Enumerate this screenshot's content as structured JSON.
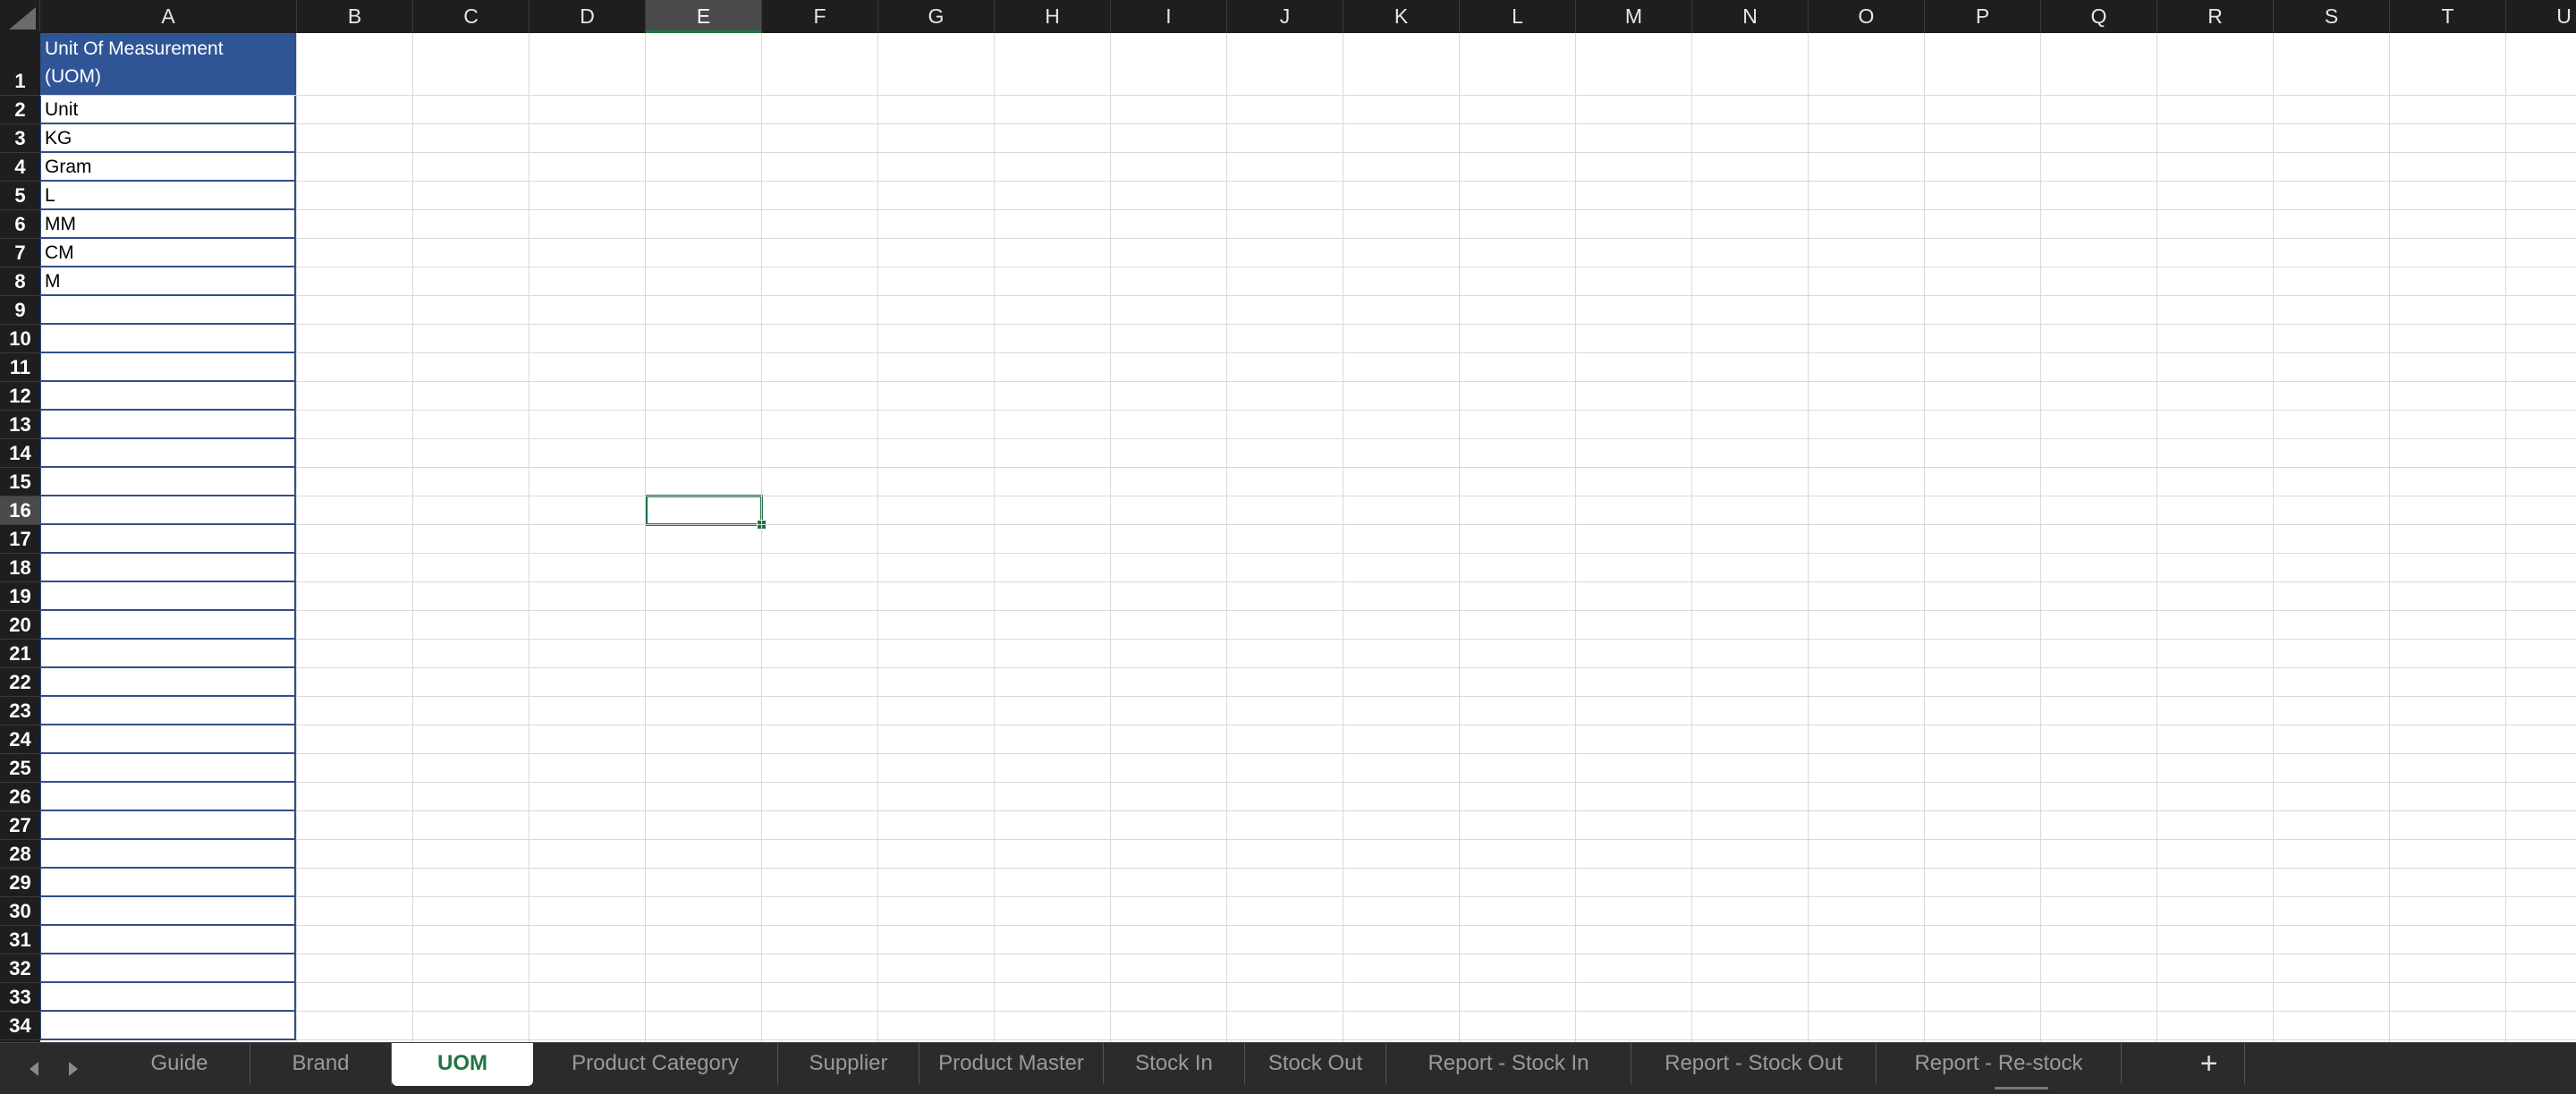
{
  "columns": [
    "A",
    "B",
    "C",
    "D",
    "E",
    "F",
    "G",
    "H",
    "I",
    "J",
    "K",
    "L",
    "M",
    "N",
    "O",
    "P",
    "Q",
    "R",
    "S",
    "T",
    "U"
  ],
  "selected_column": "E",
  "rows": [
    "1",
    "2",
    "3",
    "4",
    "5",
    "6",
    "7",
    "8",
    "9",
    "10",
    "11",
    "12",
    "13",
    "14",
    "15",
    "16",
    "17",
    "18",
    "19",
    "20",
    "21",
    "22",
    "23",
    "24",
    "25",
    "26",
    "27",
    "28",
    "29",
    "30",
    "31",
    "32",
    "33",
    "34"
  ],
  "selected_row": "16",
  "column_a": {
    "header_line1": "Unit Of Measurement",
    "header_line2": "(UOM)",
    "values": [
      "Unit",
      "KG",
      "Gram",
      "L",
      "MM",
      "CM",
      "M"
    ]
  },
  "sheet_tabs": [
    "Guide",
    "Brand",
    "UOM",
    "Product Category",
    "Supplier",
    "Product Master",
    "Stock In",
    "Stock Out",
    "Report - Stock In",
    "Report - Stock Out",
    "Report - Re-stock"
  ],
  "active_tab": "UOM",
  "add_sheet_label": "+",
  "colors": {
    "header_fill": "#2f5597",
    "accent_green": "#217346",
    "table_border": "#2f4f8c"
  }
}
